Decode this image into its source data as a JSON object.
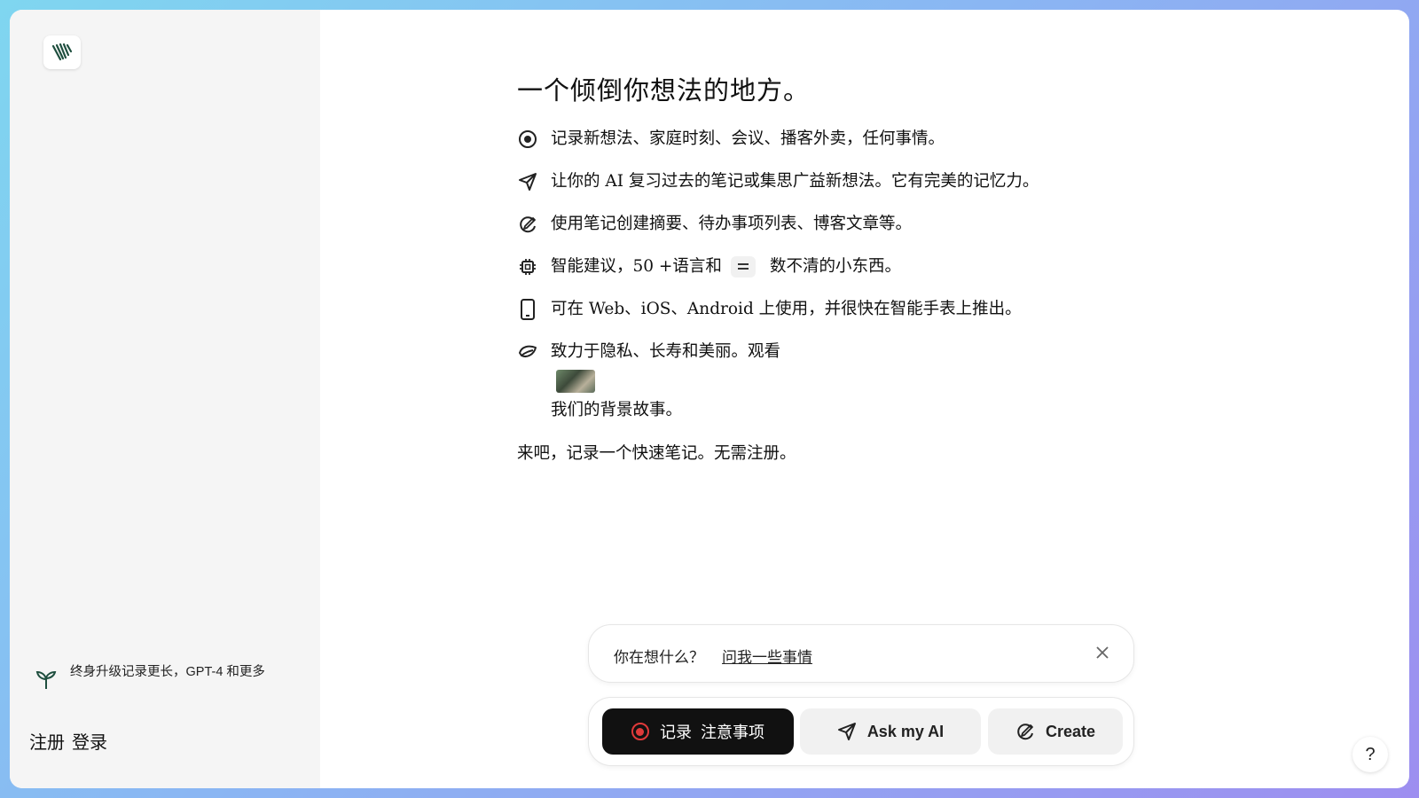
{
  "sidebar": {
    "upgrade_text": "终身升级记录更长，GPT-4 和更多",
    "signup": "注册",
    "login": "登录"
  },
  "main": {
    "headline": "一个倾倒你想法的地方。",
    "features": [
      {
        "icon": "record-icon",
        "text": "记录新想法、家庭时刻、会议、播客外卖，任何事情。"
      },
      {
        "icon": "send-icon",
        "text": "让你的 AI 复习过去的笔记或集思广益新想法。它有完美的记忆力。"
      },
      {
        "icon": "create-icon",
        "text": "使用笔记创建摘要、待办事项列表、博客文章等。"
      },
      {
        "icon": "chip-icon",
        "text_before": "智能建议，50 +语言和",
        "text_after": "数不清的小东西。"
      },
      {
        "icon": "phone-icon",
        "text": "可在 Web、iOS、Android 上使用，并很快在智能手表上推出。"
      },
      {
        "icon": "leaf-icon",
        "text_before": "致力于隐私、长寿和美丽。观看",
        "text_after": "我们的背景故事。"
      }
    ],
    "closing": "来吧，记录一个快速笔记。无需注册。"
  },
  "prompt": {
    "question": "你在想什么？",
    "ask_link": "问我一些事情"
  },
  "actions": {
    "record_label": "记录  注意事项",
    "ask_label": "Ask my AI",
    "create_label": "Create"
  },
  "help_label": "?",
  "colors": {
    "record_red": "#e03a3a",
    "dark_button": "#111111",
    "logo_green": "#1f4f3f"
  }
}
